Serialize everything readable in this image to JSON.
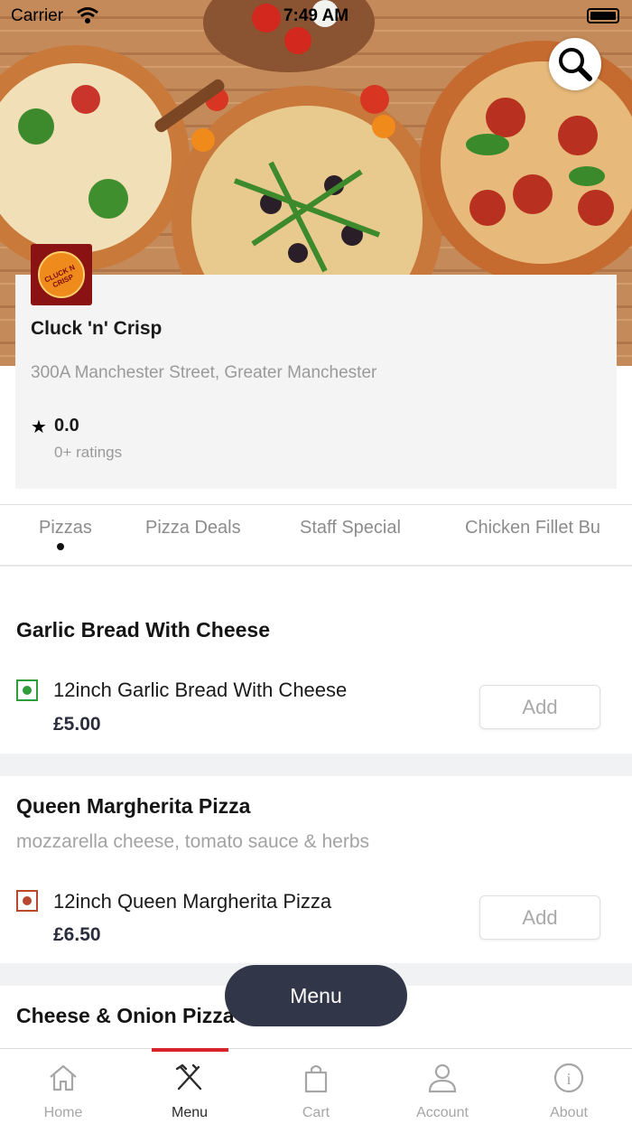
{
  "status_bar": {
    "carrier": "Carrier",
    "time": "7:49 AM"
  },
  "restaurant": {
    "name": "Cluck 'n' Crisp",
    "address": "300A Manchester Street, Greater Manchester",
    "rating": "0.0",
    "rating_count": "0+ ratings",
    "logo_text": "CLUCK N CRISP"
  },
  "categories": [
    {
      "label": "Pizzas",
      "active": true
    },
    {
      "label": "Pizza Deals",
      "active": false
    },
    {
      "label": "Staff Special",
      "active": false
    },
    {
      "label": "Chicken Fillet Bu",
      "active": false
    }
  ],
  "sections": [
    {
      "title": "Garlic Bread With Cheese",
      "description": "",
      "items": [
        {
          "name": "12inch Garlic Bread With Cheese",
          "price": "£5.00",
          "diet": "veg",
          "add_label": "Add"
        }
      ]
    },
    {
      "title": "Queen Margherita Pizza",
      "description": "mozzarella cheese, tomato sauce & herbs",
      "items": [
        {
          "name": "12inch Queen Margherita Pizza",
          "price": "£6.50",
          "diet": "non-veg",
          "add_label": "Add"
        }
      ]
    },
    {
      "title": "Cheese & Onion Pizza",
      "description": "",
      "items": []
    }
  ],
  "floating_menu_label": "Menu",
  "tab_bar": [
    {
      "label": "Home",
      "icon": "home-icon",
      "active": false
    },
    {
      "label": "Menu",
      "icon": "fork-knife-icon",
      "active": true
    },
    {
      "label": "Cart",
      "icon": "shopping-bag-icon",
      "active": false
    },
    {
      "label": "Account",
      "icon": "user-icon",
      "active": false
    },
    {
      "label": "About",
      "icon": "info-icon",
      "active": false
    }
  ],
  "colors": {
    "accent_indicator": "#d8232a",
    "pill_background": "#323649",
    "veg_green": "#2f9e3a",
    "nonveg_red": "#b8492f",
    "price_text": "#2b2d3c"
  }
}
